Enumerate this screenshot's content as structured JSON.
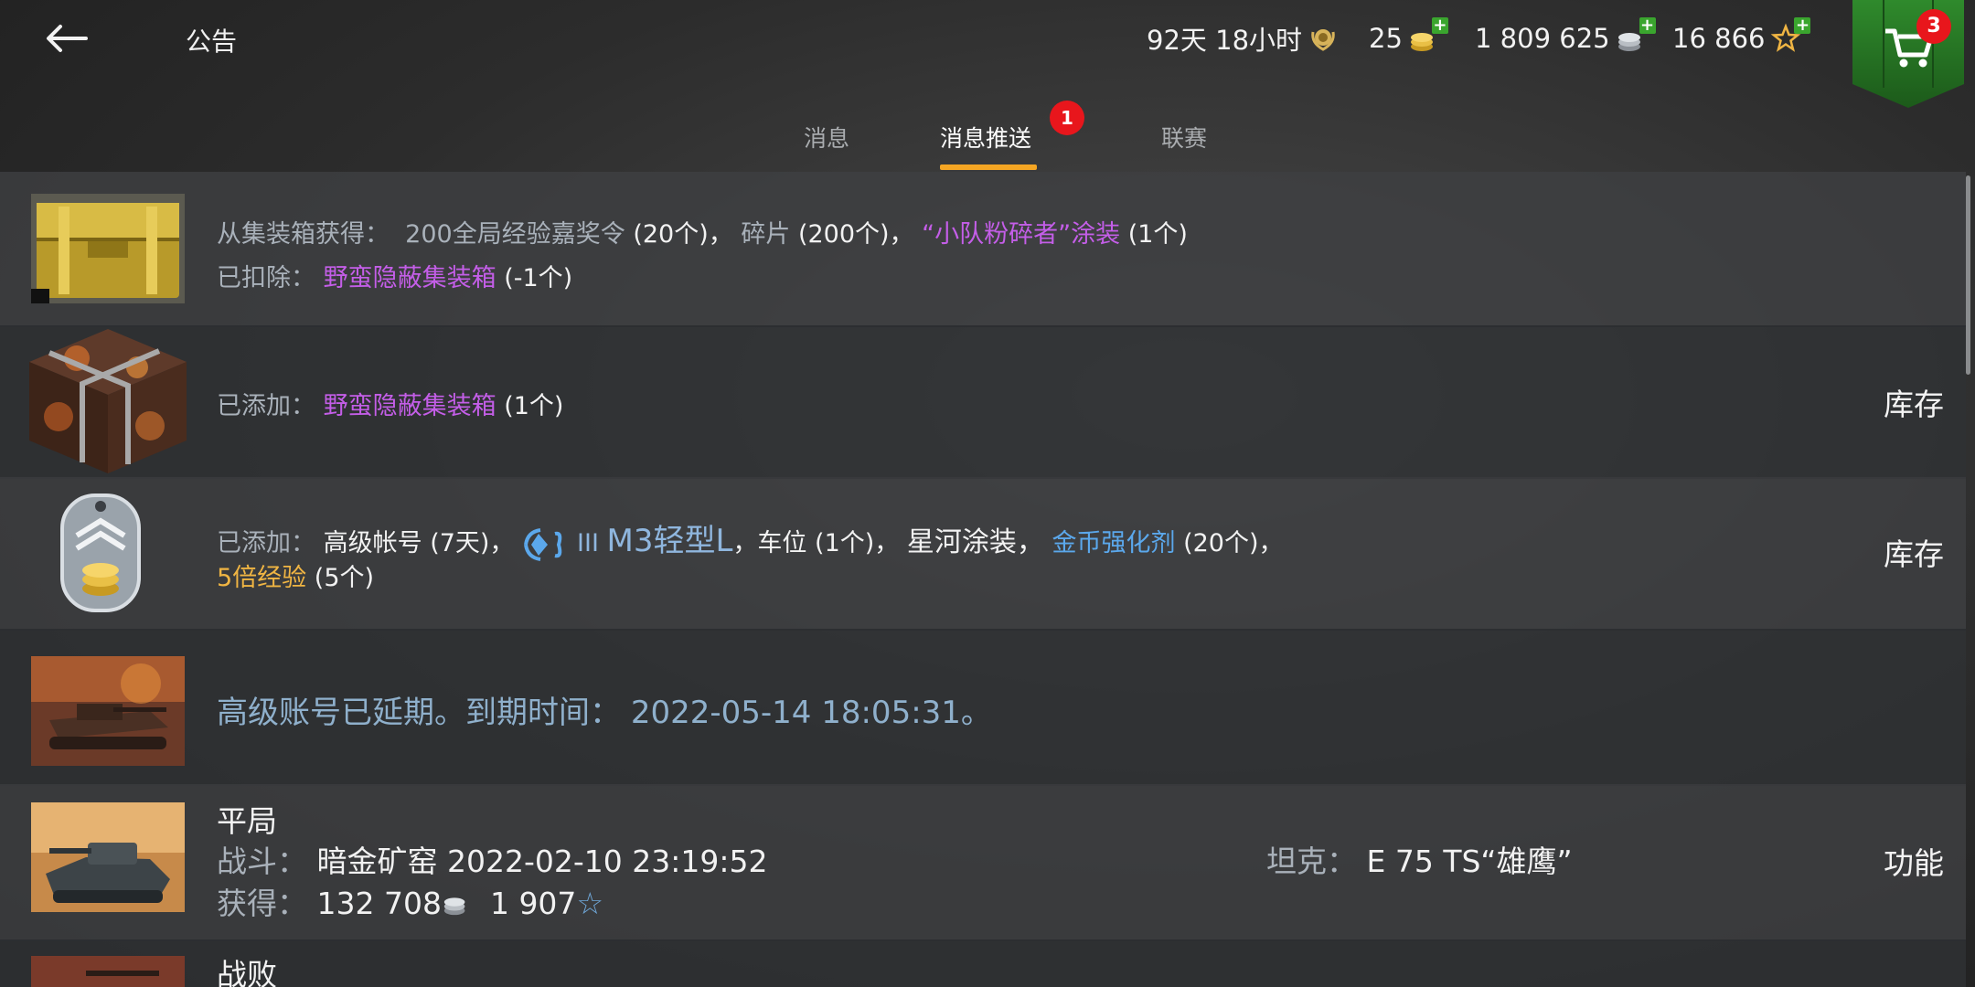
{
  "header": {
    "title": "公告",
    "timer": "92天 18小时",
    "gold": "25",
    "credits": "1 809 625",
    "free_xp": "16 866",
    "cart_count": "3"
  },
  "tabs": [
    {
      "label": "消息"
    },
    {
      "label": "消息推送",
      "badge": "1"
    },
    {
      "label": "联赛"
    }
  ],
  "messages": {
    "container": {
      "src_label": "从集装箱获得：",
      "item1": "200全局经验嘉奖令",
      "item1_qty": "(20个)，",
      "item2": "碎片",
      "item2_qty": "(200个)，",
      "item3": "“小队粉碎者”涂装",
      "item3_qty": "(1个)",
      "removed_label": "已扣除：",
      "removed_item": "野蛮隐蔽集装箱",
      "removed_qty": "(-1个)"
    },
    "added_box": {
      "label": "已添加：",
      "item": "野蛮隐蔽集装箱",
      "qty": "(1个)",
      "action": "库存"
    },
    "bundle": {
      "label": "已添加：",
      "premium": "高级帐号",
      "premium_qty": "(7天)，",
      "tank_tier": "III",
      "tank_name": "M3轻型L",
      "slot": "，车位",
      "slot_qty": "(1个)，",
      "camo": "星河涂装，",
      "booster": "金币强化剂",
      "booster_qty": "(20个)，",
      "xp": "5倍经验",
      "xp_qty": "(5个)",
      "action": "库存"
    },
    "premium_extended": {
      "text": "高级账号已延期。到期时间：",
      "datetime": "2022-05-14 18:05:31。"
    },
    "battle": {
      "result": "平局",
      "battle_label": "战斗：",
      "battle_value": "暗金矿窑 2022-02-10 23:19:52",
      "tank_label": "坦克：",
      "tank_value": "E 75 TS“雄鹰”",
      "earned_label": "获得：",
      "credits": "132 708",
      "xp": "1 907",
      "action": "功能"
    },
    "next_result": "战败"
  }
}
